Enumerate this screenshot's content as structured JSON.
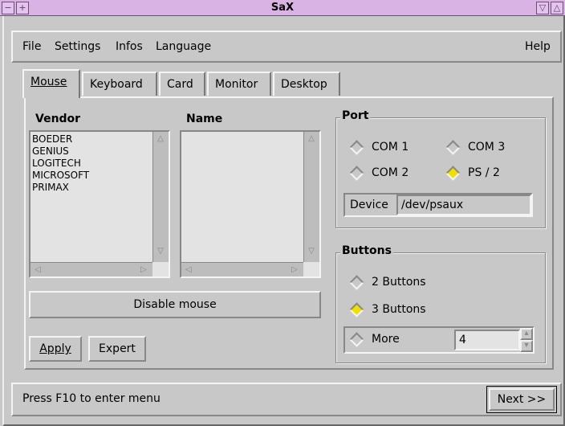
{
  "window": {
    "title": "SaX"
  },
  "menu": {
    "items": [
      "File",
      "Settings",
      "Infos",
      "Language"
    ],
    "help": "Help"
  },
  "tabs": [
    {
      "label": "Mouse",
      "active": true
    },
    {
      "label": "Keyboard",
      "active": false
    },
    {
      "label": "Card",
      "active": false
    },
    {
      "label": "Monitor",
      "active": false
    },
    {
      "label": "Desktop",
      "active": false
    }
  ],
  "mouse": {
    "vendor_header": "Vendor",
    "name_header": "Name",
    "vendors": [
      "BOEDER",
      "GENIUS",
      "LOGITECH",
      "MICROSOFT",
      "PRIMAX"
    ],
    "names": [],
    "disable_label": "Disable mouse",
    "apply_label": "Apply",
    "expert_label": "Expert",
    "port": {
      "title": "Port",
      "options": [
        {
          "label": "COM 1",
          "selected": false
        },
        {
          "label": "COM 3",
          "selected": false
        },
        {
          "label": "COM 2",
          "selected": false
        },
        {
          "label": "PS / 2",
          "selected": true
        }
      ],
      "device_label": "Device",
      "device_value": "/dev/psaux"
    },
    "buttons": {
      "title": "Buttons",
      "options": [
        {
          "label": "2 Buttons",
          "selected": false
        },
        {
          "label": "3 Buttons",
          "selected": true
        },
        {
          "label": "More",
          "selected": false
        }
      ],
      "more_value": "4"
    }
  },
  "status": {
    "text": "Press F10 to enter menu",
    "next_label": "Next >>"
  },
  "colors": {
    "titlebar": "#d9b3e3",
    "selected_radio": "#f0e000",
    "background": "#c8c8c8"
  }
}
